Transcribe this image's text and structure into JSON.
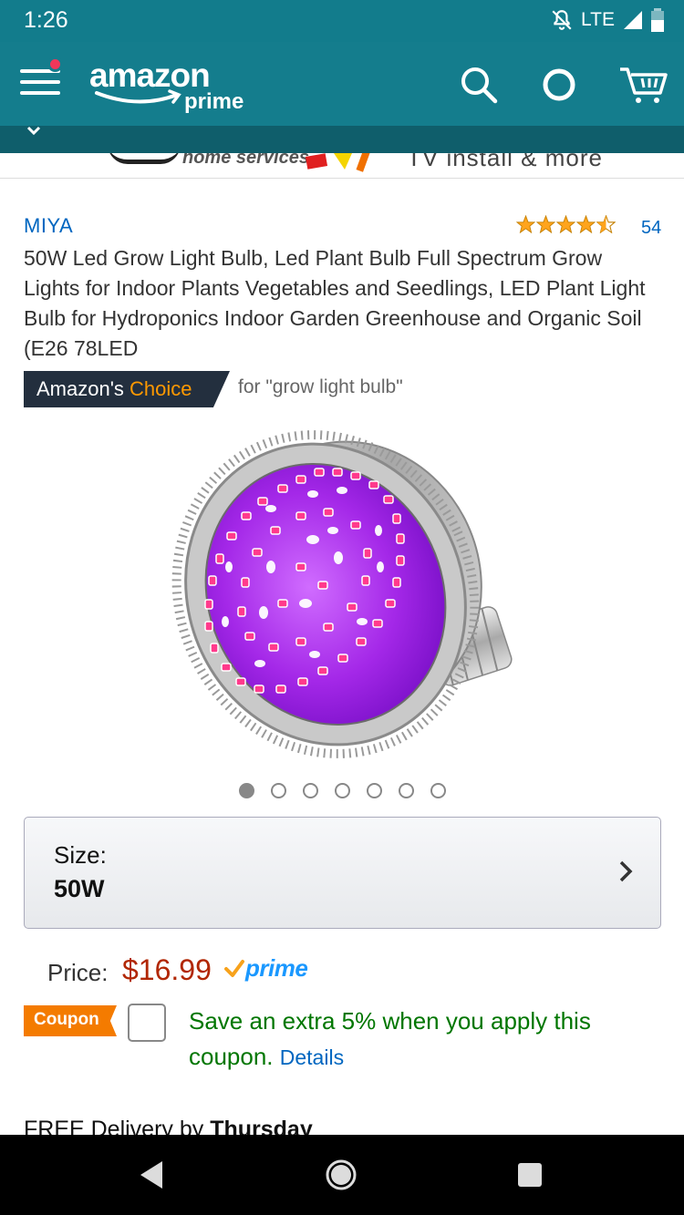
{
  "status_bar": {
    "time": "1:26",
    "network": "LTE"
  },
  "header": {
    "logo_top": "amazon",
    "logo_bottom": "prime",
    "icons": [
      "menu-icon",
      "search-icon",
      "alexa-icon",
      "cart-icon"
    ]
  },
  "promo": {
    "home_text": "home services",
    "tv_text": "TV install & more"
  },
  "product": {
    "brand": "MIYA",
    "rating_stars": 4.5,
    "rating_count": "54",
    "title": "50W Led Grow Light Bulb, Led Plant Bulb Full Spectrum Grow Lights for Indoor Plants Vegetables and Seedlings, LED Plant Light Bulb for Hydroponics Indoor Garden Greenhouse and Organic Soil (E26 78LED",
    "choice": {
      "prefix": "Amazon's ",
      "highlight": "Choice",
      "for_text": "for \"grow light bulb\""
    },
    "image_count": 7,
    "active_image": 1
  },
  "size": {
    "label": "Size:",
    "value": "50W"
  },
  "price": {
    "label": "Price:",
    "value": "$16.99",
    "prime_label": "prime"
  },
  "coupon": {
    "tag": "Coupon",
    "message": "Save an extra 5% when you apply this coupon.",
    "details_link": "Details"
  },
  "delivery": {
    "prefix": "FREE Delivery by ",
    "day": "Thursday"
  },
  "colors": {
    "header_bg": "#147d8d",
    "price": "#b12704",
    "link": "#0066c0",
    "coupon_green": "#007600",
    "coupon_orange": "#f47b00",
    "prime_blue": "#1a98ff"
  }
}
